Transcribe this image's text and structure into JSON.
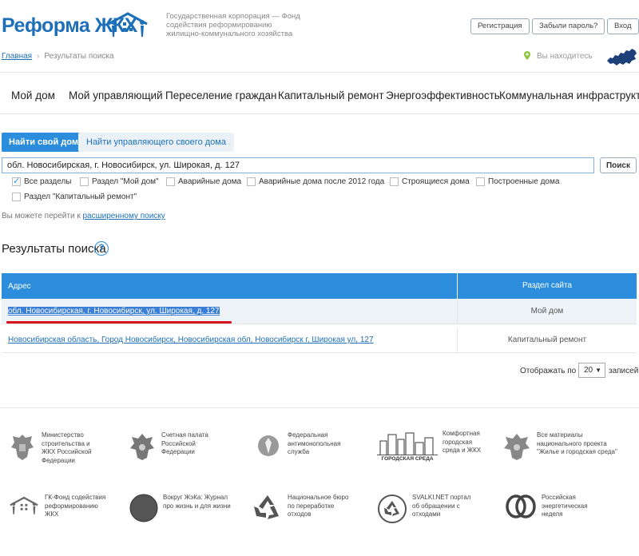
{
  "header": {
    "logo": "Реформа ЖКХ",
    "corp_text": "Государственная корпорация — Фонд содействия реформированию жилищно-коммунального хозяйства",
    "buttons": [
      "Регистрация",
      "Забыли пароль?",
      "Вход"
    ]
  },
  "breadcrumb": {
    "home": "Главная",
    "current": "Результаты поиска"
  },
  "location": "Вы находитесь",
  "nav": [
    "Мой дом",
    "Мой управляющий",
    "Переселение граждан",
    "Капитальный ремонт",
    "Энергоэффективность",
    "Коммунальная инфраструктура"
  ],
  "tabs": {
    "active": "Найти свой дом",
    "inactive": "Найти управляющего своего дома"
  },
  "search": {
    "value": "обл. Новосибирская, г. Новосибирск, ул. Широкая, д. 127",
    "button": "Поиск"
  },
  "filters": [
    {
      "label": "Все разделы",
      "checked": true
    },
    {
      "label": "Раздел \"Мой дом\"",
      "checked": false
    },
    {
      "label": "Аварийные дома",
      "checked": false
    },
    {
      "label": "Аварийные дома после 2012 года",
      "checked": false
    },
    {
      "label": "Строящиеся дома",
      "checked": false
    },
    {
      "label": "Построенные дома",
      "checked": false
    },
    {
      "label": "Раздел \"Капитальный ремонт\"",
      "checked": false
    }
  ],
  "advanced": {
    "prefix": "Вы можете перейти к",
    "link": "расширенному поиску"
  },
  "results": {
    "title": "Результаты поиска",
    "help": "?",
    "columns": [
      "Адрес",
      "Раздел сайта"
    ],
    "rows": [
      {
        "address": "обл. Новосибирская, г. Новосибирск, ул. Широкая, д. 127",
        "section": "Мой дом"
      },
      {
        "address": "Новосибирская область, Город Новосибирск, Новосибирская обл, Новосибирск г, Широкая ул, 127",
        "section": "Капитальный ремонт"
      }
    ]
  },
  "pager": {
    "label": "Отображать по",
    "value": "20",
    "unit": "записей"
  },
  "footer": [
    {
      "text": "Министерство строительства и ЖКХ Российской Федерации"
    },
    {
      "text": "Счетная палата Российской Федерации"
    },
    {
      "text": "Федеральная антимонопольная служба"
    },
    {
      "text": "Комфортная городская среда и ЖКХ",
      "logo_text": "ГОРОДСКАЯ СРЕДА"
    },
    {
      "text": "Все материалы национального проекта \"Жилье и городская среда\""
    },
    {
      "text": "ГК-Фонд содействия реформированию ЖКХ"
    },
    {
      "text": "Вокруг ЖэКа: Журнал про жизнь и для жизни"
    },
    {
      "text": "Национальное бюро по переработке отходов"
    },
    {
      "text": "SVALKI.NET портал об обращении с отходами"
    },
    {
      "text": "Российская энергетическая неделя"
    }
  ]
}
